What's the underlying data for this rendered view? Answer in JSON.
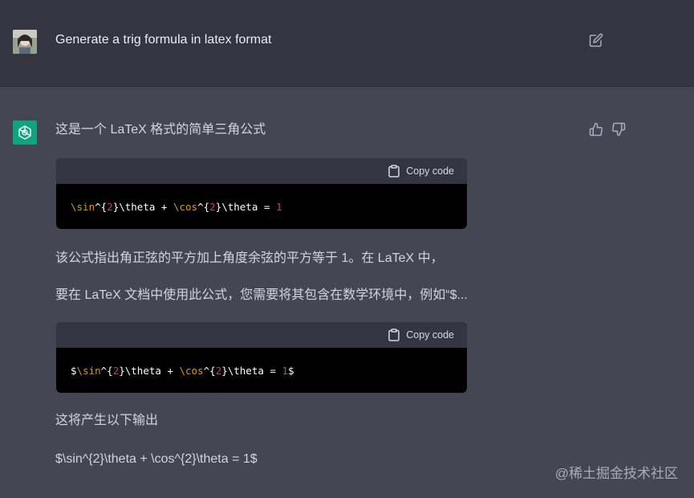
{
  "user_message": {
    "text": "Generate a trig formula in latex format"
  },
  "assistant": {
    "intro": "这是一个 LaTeX 格式的简单三角公式",
    "code_blocks": [
      {
        "copy_label": "Copy code",
        "parts": [
          "\\sin",
          "^{",
          "2",
          "}\\theta + ",
          "\\cos",
          "^{",
          "2",
          "}\\theta = ",
          "1",
          ""
        ]
      },
      {
        "copy_label": "Copy code",
        "parts": [
          "$",
          "\\sin",
          "^{",
          "2",
          "}\\theta + ",
          "\\cos",
          "^{",
          "2",
          "}\\theta = ",
          "1",
          "$"
        ]
      }
    ],
    "paragraph_1": "该公式指出角正弦的平方加上角度余弦的平方等于 1。在 LaTeX 中，",
    "paragraph_2": "要在 LaTeX 文档中使用此公式，您需要将其包含在数学环境中，例如“$...",
    "paragraph_3": "这将产生以下输出",
    "paragraph_4": "$\\sin^{2}\\theta + \\cos^{2}\\theta = 1$"
  },
  "watermark": "@稀土掘金技术社区",
  "colors": {
    "user_bg": "#343541",
    "assistant_bg": "#444654",
    "gpt_green": "#10a37f",
    "code_keyword": "#e9950c",
    "code_number": "#df3079"
  },
  "icons": [
    "user-avatar",
    "edit-icon",
    "openai-logo-icon",
    "thumbs-up-icon",
    "thumbs-down-icon",
    "clipboard-icon"
  ]
}
